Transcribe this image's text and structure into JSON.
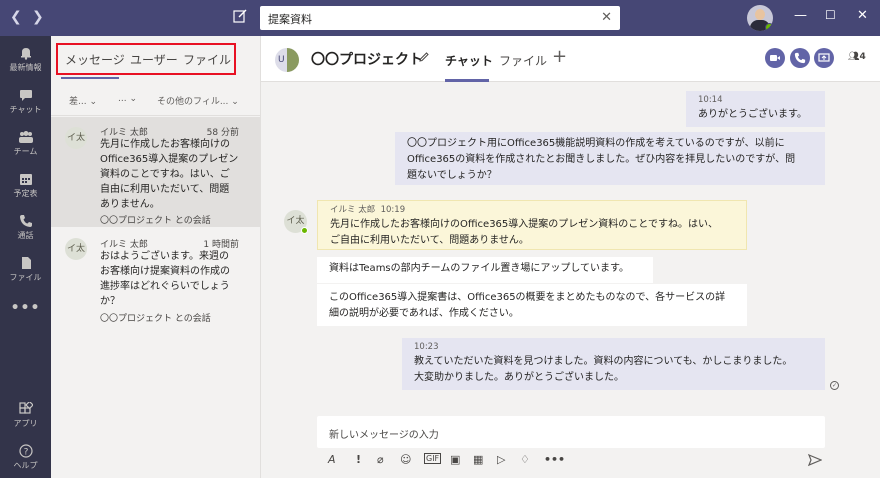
{
  "search": {
    "value": "提案資料"
  },
  "rail": {
    "items": [
      {
        "label": "最新情報",
        "icon": "bell-icon"
      },
      {
        "label": "チャット",
        "icon": "chat-icon"
      },
      {
        "label": "チーム",
        "icon": "teams-icon"
      },
      {
        "label": "予定表",
        "icon": "calendar-icon"
      },
      {
        "label": "通話",
        "icon": "phone-icon"
      },
      {
        "label": "ファイル",
        "icon": "file-icon"
      },
      {
        "label": "",
        "icon": "more-icon"
      },
      {
        "label": "アプリ",
        "icon": "apps-icon"
      },
      {
        "label": "ヘルプ",
        "icon": "help-icon"
      }
    ]
  },
  "list": {
    "tabs": [
      "メッセージ",
      "ユーザー",
      "ファイル"
    ],
    "filters": [
      "差...",
      "...",
      "その他のフィル..."
    ],
    "conversations": [
      {
        "avatar": "イ太",
        "name": "イルミ 太郎",
        "time": "58 分前",
        "lines": [
          "先月に作成したお客様向けの",
          "Office365導入提案のプレゼン",
          "資料のことですね。はい、ご",
          "自由に利用いただいて、問題",
          "ありません。"
        ],
        "sub": "〇〇プロジェクト との会話"
      },
      {
        "avatar": "イ太",
        "name": "イルミ 太郎",
        "time": "1 時間前",
        "lines": [
          "おはようございます。来週の",
          "お客様向け提案資料の作成の",
          "進捗率はどれぐらいでしょう",
          "か？"
        ],
        "sub": "〇〇プロジェクト との会話"
      }
    ]
  },
  "header": {
    "avatar": "U",
    "title": "〇〇プロジェクト",
    "tabs": [
      "チャット",
      "ファイル"
    ],
    "participants": "4"
  },
  "chat": {
    "m1": {
      "time": "10:14",
      "text": "ありがとうございます。"
    },
    "m2": {
      "lines": [
        "〇〇プロジェクト用にOffice365機能説明資料の作成を考えているのですが、以前に",
        "Office365の資料を作成されたとお聞きしました。ぜひ内容を拝見したいのですが、問",
        "題ないでしょうか？"
      ]
    },
    "m3": {
      "avatar": "イ太",
      "name": "イルミ 太郎",
      "time": "10:19",
      "lines": [
        "先月に作成したお客様向けのOffice365導入提案のプレゼン資料のことですね。はい、",
        "ご自由に利用いただいて、問題ありません。"
      ]
    },
    "m4": {
      "text": "資料はTeamsの部内チームのファイル置き場にアップしています。"
    },
    "m5": {
      "lines": [
        "このOffice365導入提案書は、Office365の概要をまとめたものなので、各サービスの詳",
        "細の説明が必要であれば、作成ください。"
      ]
    },
    "m6": {
      "time": "10:23",
      "lines": [
        "教えていただいた資料を見つけました。資料の内容についても、かしこまりました。",
        "大変助かりました。ありがとうございました。"
      ]
    }
  },
  "compose": {
    "placeholder": "新しいメッセージの入力"
  }
}
